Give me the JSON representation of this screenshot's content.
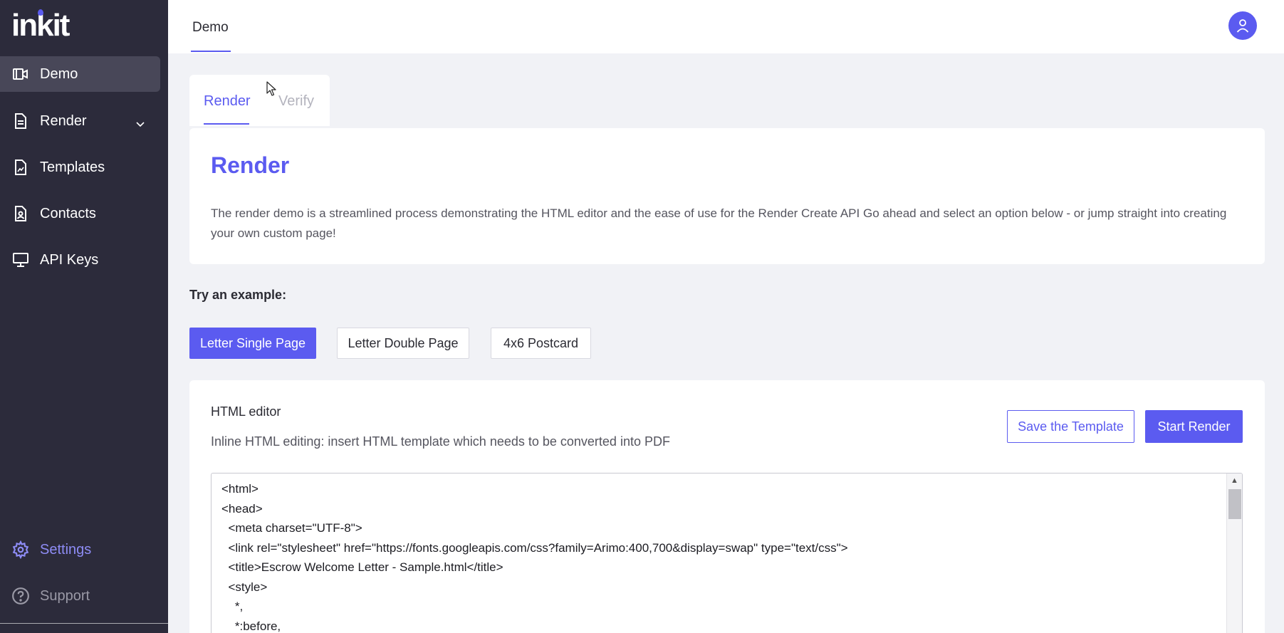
{
  "sidebar": {
    "logo": "inkit",
    "items": [
      {
        "label": "Demo",
        "icon": "video-icon"
      },
      {
        "label": "Render",
        "icon": "document-icon"
      },
      {
        "label": "Templates",
        "icon": "template-icon"
      },
      {
        "label": "Contacts",
        "icon": "contact-icon"
      },
      {
        "label": "API Keys",
        "icon": "monitor-icon"
      }
    ],
    "settings": "Settings",
    "support": "Support"
  },
  "topbar": {
    "tab": "Demo"
  },
  "subtabs": {
    "render": "Render",
    "verify": "Verify"
  },
  "render_card": {
    "title": "Render",
    "description": "The render demo is a streamlined process demonstrating the HTML editor and the ease of use for the Render Create API Go ahead and select an option below - or jump straight into creating your own custom page!"
  },
  "examples": {
    "label": "Try an example:",
    "letter_single": "Letter Single Page",
    "letter_double": "Letter Double Page",
    "postcard": "4x6 Postcard"
  },
  "editor": {
    "title": "HTML editor",
    "subtitle": "Inline HTML editing: insert HTML template which needs to be converted into PDF",
    "save_label": "Save the Template",
    "start_label": "Start Render",
    "code": "<html>\n<head>\n  <meta charset=\"UTF-8\">\n  <link rel=\"stylesheet\" href=\"https://fonts.googleapis.com/css?family=Arimo:400,700&display=swap\" type=\"text/css\">\n  <title>Escrow Welcome Letter - Sample.html</title>\n  <style>\n    *,\n    *:before,"
  },
  "colors": {
    "accent": "#5b5bf0",
    "sidebar_bg": "#2c2b3b",
    "page_bg": "#f1f2f6"
  }
}
